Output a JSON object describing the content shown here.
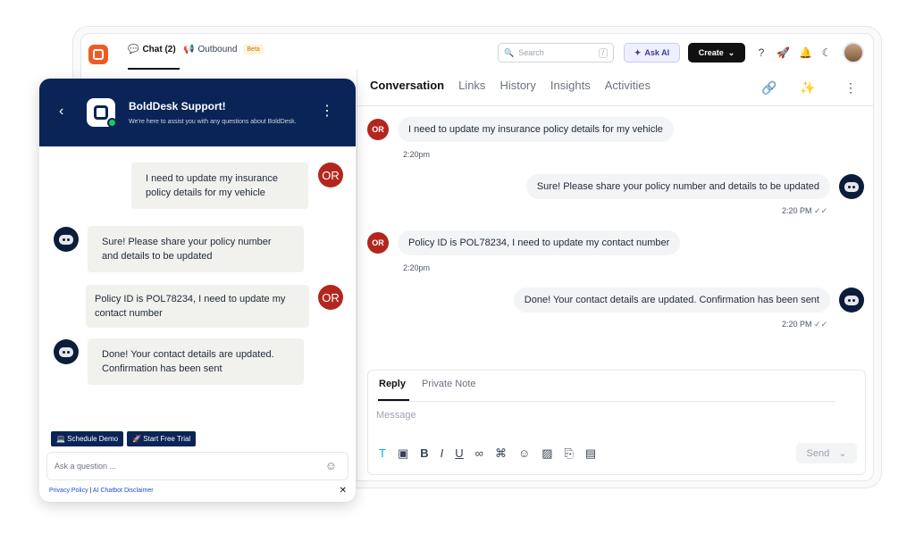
{
  "topnav": {
    "chat_tab": "Chat (2)",
    "outbound_tab": "Outbound",
    "beta_badge": "Beta",
    "search_placeholder": "Search",
    "search_shortcut": "/",
    "ask_ai": "Ask AI",
    "create": "Create"
  },
  "conversation": {
    "tabs": [
      "Conversation",
      "Links",
      "History",
      "Insights",
      "Activities"
    ],
    "messages": [
      {
        "from": "customer",
        "initials": "OR",
        "text": "I need to update my insurance policy details for my vehicle",
        "time": "2:20pm"
      },
      {
        "from": "agent",
        "text": "Sure! Please share your policy number and details to be updated",
        "time": "2:20 PM"
      },
      {
        "from": "customer",
        "initials": "OR",
        "text": "Policy ID is POL78234, I need to update my contact number",
        "time": "2:20pm"
      },
      {
        "from": "agent",
        "text": "Done! Your contact details are updated. Confirmation has been sent",
        "time": "2:20 PM"
      }
    ],
    "reply_tab": "Reply",
    "private_note_tab": "Private Note",
    "message_placeholder": "Message",
    "send": "Send"
  },
  "widget": {
    "title": "BoldDesk Support!",
    "subtitle": "We're here to assist you with any questions about BoldDesk.",
    "messages": [
      {
        "from": "customer",
        "initials": "OR",
        "text": "I need to update my insurance policy details for my vehicle"
      },
      {
        "from": "bot",
        "text": "Sure! Please share your policy number and details to be updated"
      },
      {
        "from": "customer",
        "initials": "OR",
        "text": "Policy ID is POL78234, I need to update my contact number"
      },
      {
        "from": "bot",
        "text": "Done! Your contact details are updated. Confirmation has been sent"
      }
    ],
    "schedule_demo": "💻 Schedule Demo",
    "start_trial": "🚀 Start Free Trial",
    "input_placeholder": "Ask a question ...",
    "privacy": "Privacy Policy",
    "disclaimer": "AI Chatbot Disclaimer"
  },
  "colors": {
    "accent": "#f15a24",
    "navy": "#0b2457",
    "badge_red": "#b3261e"
  }
}
